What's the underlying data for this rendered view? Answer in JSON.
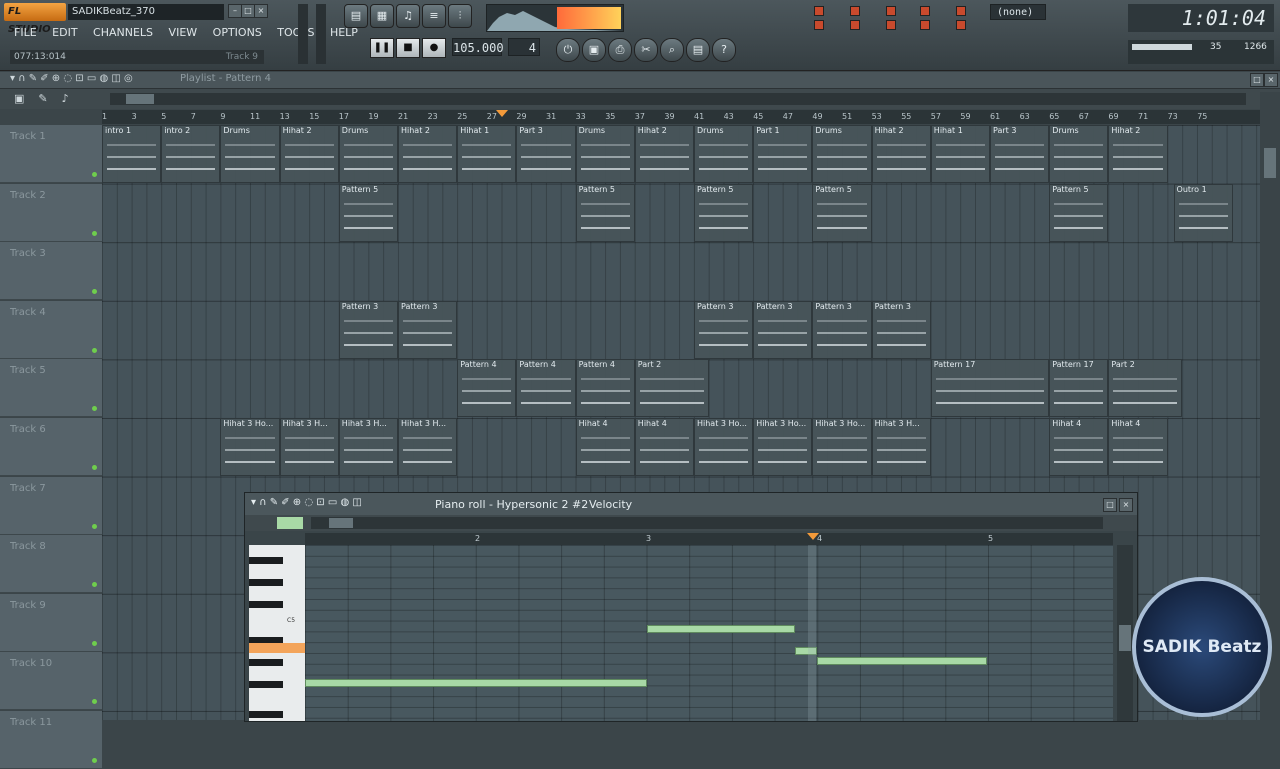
{
  "app": {
    "logo_text": "FL STUDIO",
    "project_title": "SADIKBeatz_370"
  },
  "menu": [
    "FILE",
    "EDIT",
    "CHANNELS",
    "VIEW",
    "OPTIONS",
    "TOOLS",
    "HELP"
  ],
  "hint_bar": {
    "time": "077:13:014",
    "right": "Track 9"
  },
  "tempo": "105.000",
  "pattern_number": "4",
  "song_position": "1:01:04",
  "cpu": {
    "poly": "35",
    "mem": "1266"
  },
  "pattern_selector": "(none)",
  "playlist": {
    "title": "Playlist - Pattern 4",
    "ruler": [
      "1",
      "3",
      "5",
      "7",
      "9",
      "11",
      "13",
      "15",
      "17",
      "19",
      "21",
      "23",
      "25",
      "27",
      "29",
      "31",
      "33",
      "35",
      "37",
      "39",
      "41",
      "43",
      "45",
      "47",
      "49",
      "51",
      "53",
      "55",
      "57",
      "59",
      "61",
      "63",
      "65",
      "67",
      "69",
      "71",
      "73",
      "75"
    ],
    "tracks": [
      "Track 1",
      "Track 2",
      "Track 3",
      "Track 4",
      "Track 5",
      "Track 6",
      "Track 7",
      "Track 8",
      "Track 9",
      "Track 10",
      "Track 11"
    ],
    "clips": {
      "t1": [
        "intro 1",
        "intro 2",
        "Drums",
        "Hihat 2",
        "Drums",
        "Hihat 2",
        "Hihat 1",
        "Part 3",
        "Drums",
        "Hihat 2",
        "Drums",
        "Part 1",
        "Drums",
        "Hihat 2",
        "Hihat 1",
        "Part 3",
        "Drums",
        "Hihat 2"
      ],
      "t2": [
        "Pattern 5",
        "Pattern 5",
        "Pattern 5",
        "Pattern 5",
        "Pattern 5",
        "Outro 1"
      ],
      "t4": [
        "Pattern 3",
        "Pattern 3",
        "Pattern 3",
        "Pattern 3",
        "Pattern 3",
        "Pattern 3"
      ],
      "t5": [
        "Pattern 4",
        "Pattern 4",
        "Pattern 4",
        "Part 2",
        "Pattern 17",
        "Pattern 17",
        "Part 2"
      ],
      "t6": [
        "Hihat 3 Ho...",
        "Hihat 3 H...",
        "Hihat 3 H...",
        "Hihat 3 H...",
        "Hihat 4",
        "Hihat 4",
        "Hihat 3 Ho...",
        "Hihat 3 Ho...",
        "Hihat 3 Ho...",
        "Hihat 3 H...",
        "Hihat 4",
        "Hihat 4"
      ]
    }
  },
  "piano_roll": {
    "title": "Piano roll - Hypersonic 2 #2",
    "mode": "Velocity",
    "ruler": [
      "2",
      "3",
      "4",
      "5"
    ],
    "key_label": "C5"
  },
  "watermark": "SADIK Beatz",
  "colors": {
    "accent": "#f39a3a",
    "note": "#a8d9a6",
    "track_active": "#6fce4d"
  }
}
